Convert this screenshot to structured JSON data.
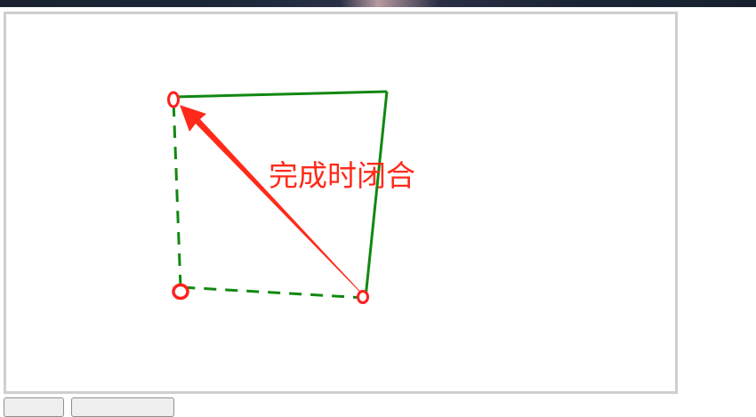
{
  "annotation": {
    "text": "完成时闭合",
    "color": "#ff2a1a"
  },
  "colors": {
    "polygon_stroke": "#118811",
    "vertex_marker": "#ff2020",
    "arrow": "#ff2a1a",
    "canvas_border": "#cfcfcf"
  },
  "buttons": {
    "first_label": "",
    "second_label": ""
  }
}
